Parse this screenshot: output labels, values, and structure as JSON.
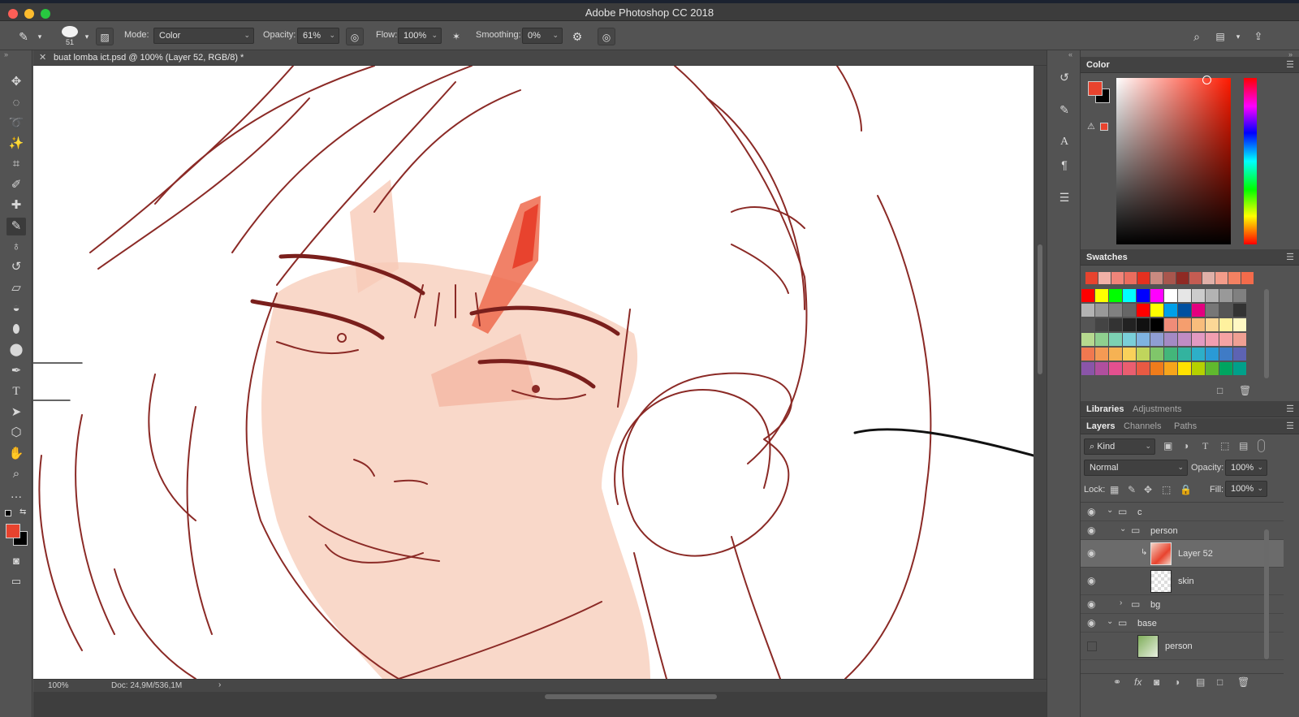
{
  "window": {
    "title": "Adobe Photoshop CC 2018"
  },
  "options_bar": {
    "brush_size": "51",
    "mode_label": "Mode:",
    "mode_value": "Color",
    "opacity_label": "Opacity:",
    "opacity_value": "61%",
    "flow_label": "Flow:",
    "flow_value": "100%",
    "smoothing_label": "Smoothing:",
    "smoothing_value": "0%"
  },
  "document": {
    "tab_title": "buat lomba ict.psd @ 100% (Layer 52, RGB/8) *",
    "zoom": "100%",
    "doc_size": "Doc: 24,9M/536,1M"
  },
  "colors": {
    "foreground": "#e8432e",
    "background": "#000000",
    "line_art": "#8b2a26",
    "skin": "#f9d8c9"
  },
  "panels": {
    "color_tab": "Color",
    "swatches_tab": "Swatches",
    "libraries_tab": "Libraries",
    "adjustments_tab": "Adjustments",
    "layers_tab": "Layers",
    "channels_tab": "Channels",
    "paths_tab": "Paths",
    "filter_kind": "Kind",
    "blend_mode": "Normal",
    "opacity_label": "Opacity:",
    "opacity_value": "100%",
    "lock_label": "Lock:",
    "fill_label": "Fill:",
    "fill_value": "100%"
  },
  "swatches": {
    "row1": [
      "#e8432e",
      "#f2b0a6",
      "#f0857a",
      "#ea6d5e",
      "#e4301f",
      "#c98a80",
      "#a8564d",
      "#8f2a24",
      "#c45c52",
      "#e0b0a8",
      "#f39c8a",
      "#f38162",
      "#f36b4b"
    ],
    "grid": [
      [
        "#ff0000",
        "#ffff00",
        "#00ff00",
        "#00ffff",
        "#0000ff",
        "#ff00ff",
        "#ffffff",
        "#e6e6e6",
        "#cccccc",
        "#b3b3b3",
        "#999999",
        "#808080"
      ],
      [
        "#b3b3b3",
        "#999999",
        "#808080",
        "#666666",
        "#ff0000",
        "#ffff00",
        "#00a0e9",
        "#0050a0",
        "#e4007f",
        "#777777",
        "#555555",
        "#333333"
      ],
      [
        "#555555",
        "#444444",
        "#333333",
        "#222222",
        "#111111",
        "#000000",
        "#f08c78",
        "#f59e6e",
        "#f8bd7c",
        "#fbd796",
        "#fff19e",
        "#fff8c4"
      ],
      [
        "#b6d98f",
        "#8fcf8f",
        "#7cd1b3",
        "#7acfd9",
        "#7fb3e0",
        "#8f9ed3",
        "#a48ac4",
        "#c08cc4",
        "#e39ac2",
        "#f19eb0",
        "#f5a3a3",
        "#f0a093"
      ],
      [
        "#f07850",
        "#f49a54",
        "#f6b253",
        "#f9d15a",
        "#c0d55c",
        "#80c66a",
        "#43b67a",
        "#33b39f",
        "#2dafc8",
        "#2a9ad6",
        "#3f7bc6",
        "#5d63b3"
      ],
      [
        "#8a55a8",
        "#b04f9e",
        "#e3508f",
        "#ea5e70",
        "#e85a43",
        "#ef7c1b",
        "#f7a51b",
        "#ffe100",
        "#b5d100",
        "#60b92e",
        "#00a560",
        "#00a08a"
      ]
    ]
  },
  "layers": [
    {
      "name": "c",
      "kind": "group",
      "visible": true,
      "depth": 0,
      "expanded": true
    },
    {
      "name": "person",
      "kind": "group",
      "visible": true,
      "depth": 1,
      "expanded": true
    },
    {
      "name": "Layer 52",
      "kind": "layer",
      "visible": true,
      "depth": 2,
      "selected": true
    },
    {
      "name": "skin",
      "kind": "layer",
      "visible": true,
      "depth": 2
    },
    {
      "name": "bg",
      "kind": "group",
      "visible": true,
      "depth": 1,
      "expanded": false
    },
    {
      "name": "base",
      "kind": "group",
      "visible": true,
      "depth": 0,
      "expanded": true
    },
    {
      "name": "person",
      "kind": "layer",
      "visible": false,
      "depth": 1
    }
  ]
}
